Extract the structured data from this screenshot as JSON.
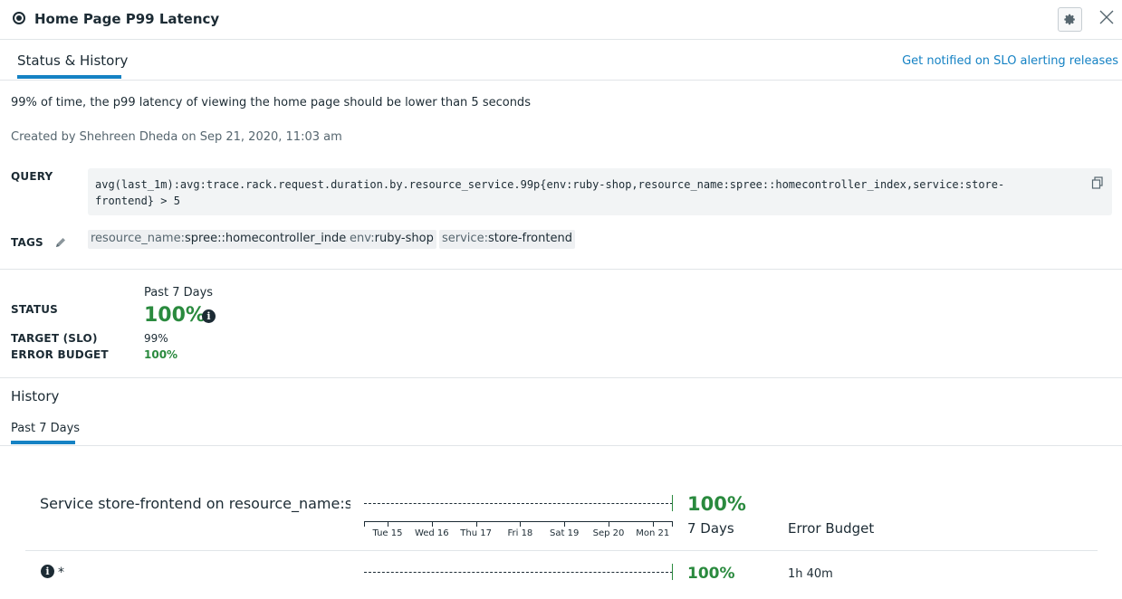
{
  "header": {
    "title": "Home Page P99 Latency",
    "slo_icon": "slo-monitor-icon",
    "settings_icon": "gear-icon",
    "close_icon": "close-icon"
  },
  "tabs": {
    "active": "Status & History",
    "notify_link": "Get notified on SLO alerting releases"
  },
  "details": {
    "description": "99% of time, the p99 latency of viewing the home page should be lower than 5 seconds",
    "created": "Created by Shehreen Dheda on Sep 21, 2020, 11:03 am",
    "query_label": "QUERY",
    "query_line1": "avg(last_1m):avg:trace.rack.request.duration.by.resource_service.99p{env:ruby-shop,resource_name:spree::homecontroller_index,service:store-",
    "query_line2": "frontend} > 5",
    "copy_icon": "copy-icon",
    "tags_label": "TAGS",
    "edit_icon": "pencil-icon",
    "tags": [
      {
        "key": "resource_name:",
        "value": "spree::homecontroller_index"
      },
      {
        "key": "env:",
        "value": "ruby-shop"
      },
      {
        "key": "service:",
        "value": "store-frontend"
      }
    ]
  },
  "status": {
    "period": "Past 7 Days",
    "status_label": "STATUS",
    "status_value": "100%",
    "target_label": "TARGET (SLO)",
    "target_value": "99%",
    "budget_label": "ERROR BUDGET",
    "budget_value": "100%"
  },
  "history": {
    "title": "History",
    "tab": "Past 7 Days",
    "row_label": "Service store-frontend on resource_name:spree::homecontroller_index",
    "summary_pct": "100%",
    "days_label": "7 Days",
    "error_budget_label": "Error Budget",
    "x_ticks": [
      "Tue 15",
      "Wed 16",
      "Thu 17",
      "Fri 18",
      "Sat 19",
      "Sep 20",
      "Mon 21"
    ],
    "sub_row_marker": "*",
    "sub_row_pct": "100%",
    "sub_row_budget": "1h 40m"
  },
  "colors": {
    "accent": "#1582c4",
    "success": "#2a8a3e",
    "text": "#1c2b34"
  }
}
